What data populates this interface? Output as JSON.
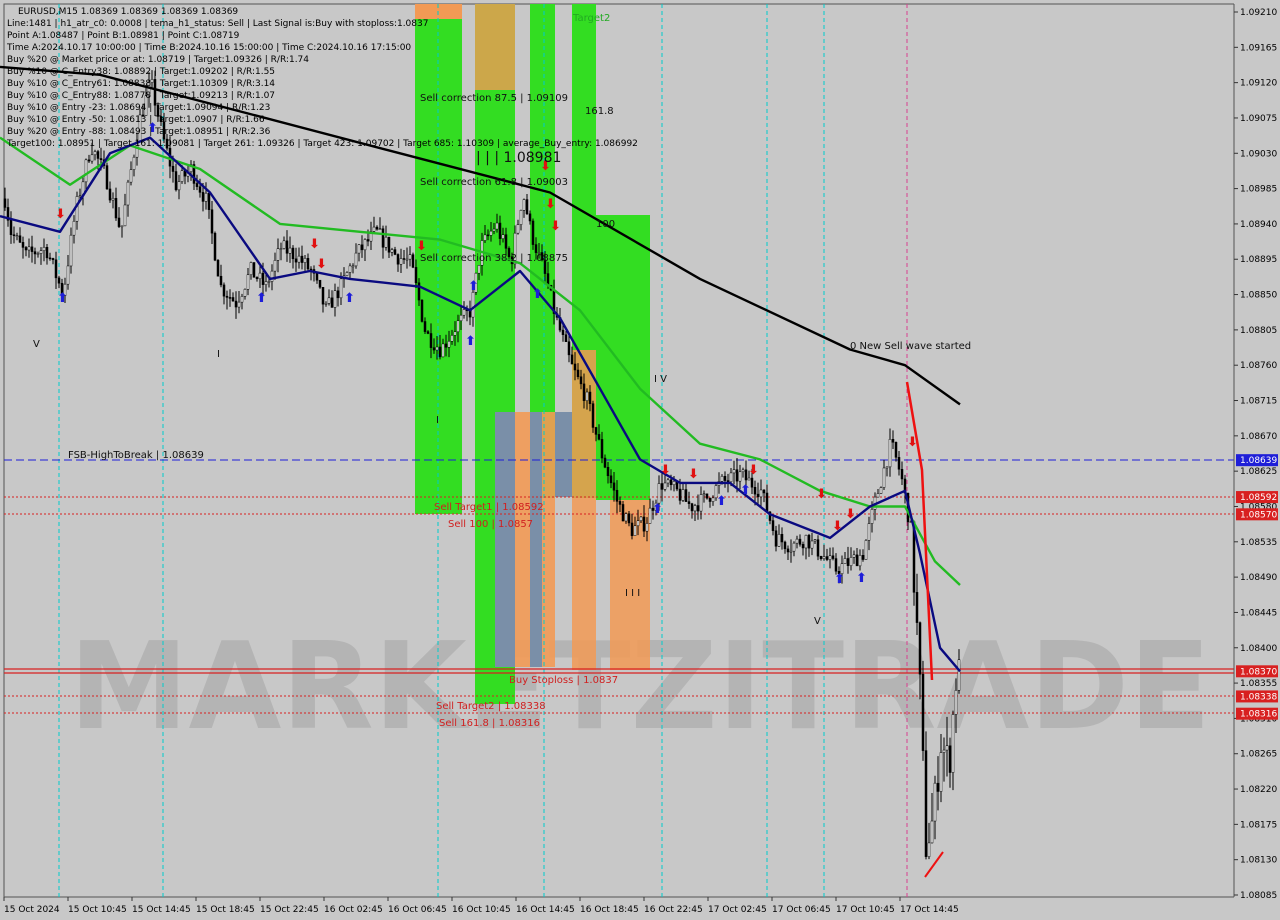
{
  "window": {
    "symbol_line": "EURUSD,M15  1.08369 1.08369 1.08369 1.08369"
  },
  "info_lines": [
    "Line:1481 | h1_atr_c0: 0.0008 | tema_h1_status: Sell | Last Signal is:Buy with stoploss:1.0837",
    "Point A:1.08487 | Point B:1.08981 | Point C:1.08719",
    "Time A:2024.10.17 10:00:00 | Time B:2024.10.16 15:00:00 | Time C:2024.10.16 17:15:00",
    "Buy %20 @ Market price or at: 1.08719 | Target:1.09326 | R/R:1.74",
    "Buy %10 @ C_Entry38: 1.08892 | Target:1.09202 | R/R:1.55",
    "Buy %10 @ C_Entry61: 1.08838 | Target:1.10309 | R/R:3.14",
    "Buy %10 @ C_Entry88: 1.08778 | Target:1.09213 | R/R:1.07",
    "Buy %10 @ Entry -23: 1.08694 | Target:1.09094 | R/R:1.23",
    "Buy %10 @ Entry -50: 1.08613 | Target:1.0907 | R/R:1.66",
    "Buy %20 @ Entry -88: 1.08493 | Target:1.08951 | R/R:2.36",
    "Target100: 1.08951 | Target 161: 1.09081 | Target 261: 1.09326 | Target 423: 1.09702 | Target 685: 1.10309 | average_Buy_entry: 1.086992"
  ],
  "price_axis": {
    "ticks": [
      "1.09210",
      "1.09165",
      "1.09120",
      "1.09075",
      "1.09030",
      "1.08985",
      "1.08940",
      "1.08895",
      "1.08850",
      "1.08805",
      "1.08760",
      "1.08715",
      "1.08670",
      "1.08625",
      "1.08580",
      "1.08535",
      "1.08490",
      "1.08445",
      "1.08400",
      "1.08355",
      "1.08310",
      "1.08265",
      "1.08220",
      "1.08175",
      "1.08130",
      "1.08085"
    ],
    "badges": [
      {
        "text": "1.08639",
        "color": "#1e1ed8"
      },
      {
        "text": "1.08592",
        "color": "#d82020"
      },
      {
        "text": "1.08570",
        "color": "#d82020"
      },
      {
        "text": "1.08370",
        "color": "#d82020"
      },
      {
        "text": "1.08338",
        "color": "#d82020"
      },
      {
        "text": "1.08316",
        "color": "#d82020"
      }
    ]
  },
  "time_axis": [
    "15 Oct 2024",
    "15 Oct 10:45",
    "15 Oct 14:45",
    "15 Oct 18:45",
    "15 Oct 22:45",
    "16 Oct 02:45",
    "16 Oct 06:45",
    "16 Oct 10:45",
    "16 Oct 14:45",
    "16 Oct 18:45",
    "16 Oct 22:45",
    "17 Oct 02:45",
    "17 Oct 06:45",
    "17 Oct 10:45",
    "17 Oct 14:45"
  ],
  "annotations": {
    "target2": "Target2",
    "sell_corr_875": "Sell correction 87.5 | 1.09109",
    "sell_corr_618": "Sell correction 61.8 | 1.09003",
    "sell_corr_382": "Sell correction 38.2 | 1.08875",
    "fib_1618": "161.8",
    "fib_100": "100",
    "high_label": "| | | 1.08981",
    "sell_target1": "Sell Target1 | 1.08592",
    "sell_100": "Sell 100 | 1.0857",
    "buy_stoploss": "Buy Stoploss | 1.0837",
    "sell_target2": "Sell Target2 | 1.08338",
    "sell_1618": "Sell 161.8 | 1.08316",
    "fsb": "FSB-HighToBreak | 1.08639",
    "new_wave": "0 New Sell wave started",
    "wave_iv": "I V",
    "wave_v1": "V",
    "wave_v2": "V",
    "wave_i": "I",
    "wave_i2": "I",
    "wave_iii": "I I I"
  },
  "watermark": "MARKETZITRADE",
  "colors": {
    "background": "#c8c8c8",
    "green": "#33dd22",
    "orange": "#f29a55",
    "gray_blue": "#7a8fa8",
    "ma_black": "#000000",
    "ma_green": "#22bb22",
    "ma_navy": "#0a0a80",
    "sell_red": "#d82020",
    "buy_blue": "#1e1ed8"
  },
  "chart_data": {
    "type": "candlestick",
    "symbol": "EURUSD",
    "timeframe": "M15",
    "ylim": [
      1.08085,
      1.0921
    ],
    "key_levels": [
      {
        "name": "FSB-HighToBreak",
        "value": 1.08639
      },
      {
        "name": "Sell Target1",
        "value": 1.08592
      },
      {
        "name": "Sell 100",
        "value": 1.0857
      },
      {
        "name": "Buy Stoploss",
        "value": 1.0837
      },
      {
        "name": "Sell Target2",
        "value": 1.08338
      },
      {
        "name": "Sell 161.8",
        "value": 1.08316
      }
    ],
    "price_path": [
      [
        0,
        1.09
      ],
      [
        10,
        1.0893
      ],
      [
        25,
        1.089
      ],
      [
        45,
        1.0891
      ],
      [
        62,
        1.0885
      ],
      [
        75,
        1.0896
      ],
      [
        90,
        1.0904
      ],
      [
        105,
        1.09
      ],
      [
        120,
        1.0893
      ],
      [
        138,
        1.0907
      ],
      [
        150,
        1.0912
      ],
      [
        162,
        1.0905
      ],
      [
        175,
        1.0899
      ],
      [
        190,
        1.0901
      ],
      [
        205,
        1.0897
      ],
      [
        220,
        1.0886
      ],
      [
        235,
        1.0884
      ],
      [
        250,
        1.0888
      ],
      [
        265,
        1.0886
      ],
      [
        280,
        1.0891
      ],
      [
        295,
        1.089
      ],
      [
        310,
        1.0888
      ],
      [
        325,
        1.0883
      ],
      [
        340,
        1.0886
      ],
      [
        355,
        1.089
      ],
      [
        375,
        1.0893
      ],
      [
        395,
        1.089
      ],
      [
        410,
        1.0889
      ],
      [
        425,
        1.088
      ],
      [
        440,
        1.0878
      ],
      [
        455,
        1.0881
      ],
      [
        470,
        1.0883
      ],
      [
        480,
        1.0891
      ],
      [
        495,
        1.0894
      ],
      [
        510,
        1.0889
      ],
      [
        522,
        1.0898
      ],
      [
        530,
        1.0893
      ],
      [
        545,
        1.0887
      ],
      [
        555,
        1.0882
      ],
      [
        570,
        1.0876
      ],
      [
        585,
        1.0872
      ],
      [
        600,
        1.0865
      ],
      [
        615,
        1.0859
      ],
      [
        630,
        1.0855
      ],
      [
        645,
        1.0856
      ],
      [
        660,
        1.0861
      ],
      [
        675,
        1.086
      ],
      [
        690,
        1.0858
      ],
      [
        705,
        1.0859
      ],
      [
        720,
        1.0861
      ],
      [
        740,
        1.0862
      ],
      [
        760,
        1.086
      ],
      [
        775,
        1.0854
      ],
      [
        790,
        1.0853
      ],
      [
        805,
        1.0854
      ],
      [
        820,
        1.0852
      ],
      [
        835,
        1.085
      ],
      [
        850,
        1.0851
      ],
      [
        862,
        1.0852
      ],
      [
        875,
        1.0859
      ],
      [
        890,
        1.0866
      ],
      [
        900,
        1.0862
      ],
      [
        910,
        1.0855
      ],
      [
        918,
        1.0838
      ],
      [
        925,
        1.0815
      ],
      [
        932,
        1.0818
      ],
      [
        940,
        1.0828
      ],
      [
        948,
        1.0825
      ],
      [
        955,
        1.0836
      ],
      [
        960,
        1.0837
      ]
    ],
    "moving_averages": [
      {
        "color": "#000000",
        "points": [
          [
            0,
            1.0914
          ],
          [
            100,
            1.0913
          ],
          [
            250,
            1.0908
          ],
          [
            400,
            1.0903
          ],
          [
            550,
            1.0898
          ],
          [
            700,
            1.0887
          ],
          [
            850,
            1.0878
          ],
          [
            905,
            1.0876
          ],
          [
            960,
            1.0871
          ]
        ]
      },
      {
        "color": "#22bb22",
        "points": [
          [
            0,
            1.0905
          ],
          [
            70,
            1.0899
          ],
          [
            130,
            1.0904
          ],
          [
            200,
            1.0901
          ],
          [
            280,
            1.0894
          ],
          [
            360,
            1.0893
          ],
          [
            440,
            1.0892
          ],
          [
            520,
            1.0889
          ],
          [
            580,
            1.0883
          ],
          [
            640,
            1.0873
          ],
          [
            700,
            1.0866
          ],
          [
            760,
            1.0864
          ],
          [
            820,
            1.086
          ],
          [
            870,
            1.0858
          ],
          [
            905,
            1.0858
          ],
          [
            935,
            1.0851
          ],
          [
            960,
            1.0848
          ]
        ]
      },
      {
        "color": "#0a0a80",
        "points": [
          [
            0,
            1.0895
          ],
          [
            60,
            1.0893
          ],
          [
            110,
            1.0903
          ],
          [
            150,
            1.0905
          ],
          [
            210,
            1.0898
          ],
          [
            270,
            1.0887
          ],
          [
            310,
            1.0888
          ],
          [
            350,
            1.0887
          ],
          [
            420,
            1.0886
          ],
          [
            470,
            1.0883
          ],
          [
            520,
            1.0888
          ],
          [
            560,
            1.0882
          ],
          [
            600,
            1.0873
          ],
          [
            640,
            1.0864
          ],
          [
            680,
            1.0861
          ],
          [
            730,
            1.0861
          ],
          [
            770,
            1.0857
          ],
          [
            830,
            1.0854
          ],
          [
            870,
            1.0858
          ],
          [
            905,
            1.086
          ],
          [
            920,
            1.0852
          ],
          [
            940,
            1.084
          ],
          [
            960,
            1.0837
          ]
        ]
      }
    ]
  }
}
